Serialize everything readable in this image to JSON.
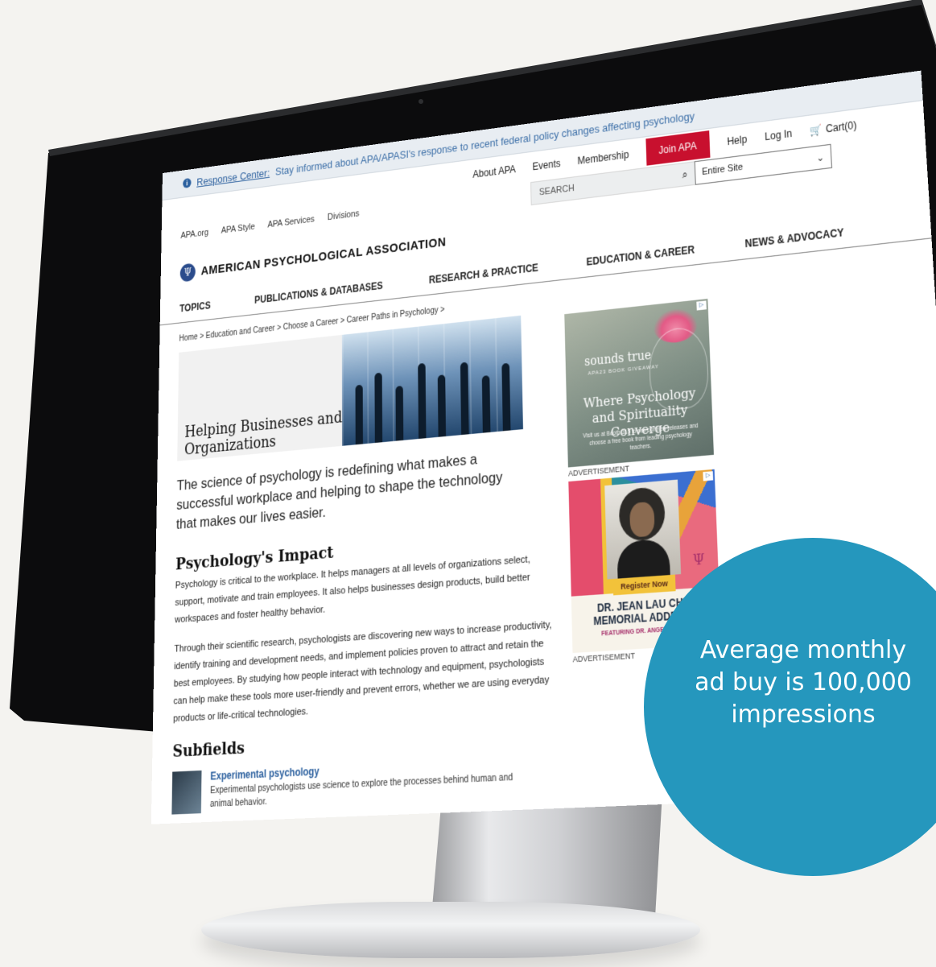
{
  "notice_bar": {
    "link_text": "Response Center:",
    "message": "Stay informed about APA/APASI's response to recent federal policy changes affecting psychology"
  },
  "utility_nav": {
    "links": [
      "About APA",
      "Events",
      "Membership"
    ],
    "join_label": "Join APA",
    "help_label": "Help",
    "login_label": "Log In",
    "cart_label": "Cart(0)"
  },
  "site_links": [
    "APA.org",
    "APA Style",
    "APA Services",
    "Divisions"
  ],
  "search": {
    "placeholder": "SEARCH",
    "scope_value": "Entire Site"
  },
  "brand": {
    "name": "AMERICAN PSYCHOLOGICAL ASSOCIATION"
  },
  "main_nav": [
    "TOPICS",
    "PUBLICATIONS & DATABASES",
    "RESEARCH & PRACTICE",
    "EDUCATION & CAREER",
    "NEWS & ADVOCACY"
  ],
  "breadcrumb": "Home > Education and Career > Choose a Career > Career Paths in Psychology >",
  "hero": {
    "title": "Helping Businesses and Organizations"
  },
  "intro": "The science of psychology is redefining what makes a successful workplace and helping to shape the technology that makes our lives easier.",
  "impact": {
    "heading": "Psychology's Impact",
    "paragraph1": "Psychology is critical to the workplace. It helps managers at all levels of organizations select, support, motivate and train employees. It also helps businesses design products, build better workspaces and foster healthy behavior.",
    "paragraph2": "Through their scientific research, psychologists are discovering new ways to increase productivity, identify training and development needs, and implement policies proven to attract and retain the best employees. By studying how people interact with technology and equipment, psychologists can help make these tools more user-friendly and prevent errors, whether we are using everyday products or life-critical technologies."
  },
  "subfields": {
    "heading": "Subfields",
    "item_title": "Experimental psychology",
    "item_desc": "Experimental psychologists use science to explore the processes behind human and animal behavior."
  },
  "ad1": {
    "brand": "sounds true",
    "sub": "APA23 BOOK GIVEAWAY",
    "headline": "Where Psychology and Spirituality Converge",
    "body": "Visit us at Booth 315 to see our new releases and choose a free book from leading psychology teachers.",
    "label": "ADVERTISEMENT"
  },
  "ad2": {
    "button": "Register Now",
    "name": "DR. JEAN LAU CHIN MEMORIAL ADDRESS",
    "featuring": "FEATURING DR. ANGELA DAVIS",
    "label": "ADVERTISEMENT"
  },
  "callout": {
    "text": "Average monthly ad buy is 100,000 impressions"
  },
  "colors": {
    "apa_blue": "#2a5f9e",
    "join_red": "#c8102e",
    "callout_teal": "#2597bd"
  },
  "icons": {
    "info": "info-icon",
    "search": "search-icon",
    "cart": "cart-icon",
    "chevron": "chevron-down-icon",
    "logo": "apple-logo-icon"
  }
}
